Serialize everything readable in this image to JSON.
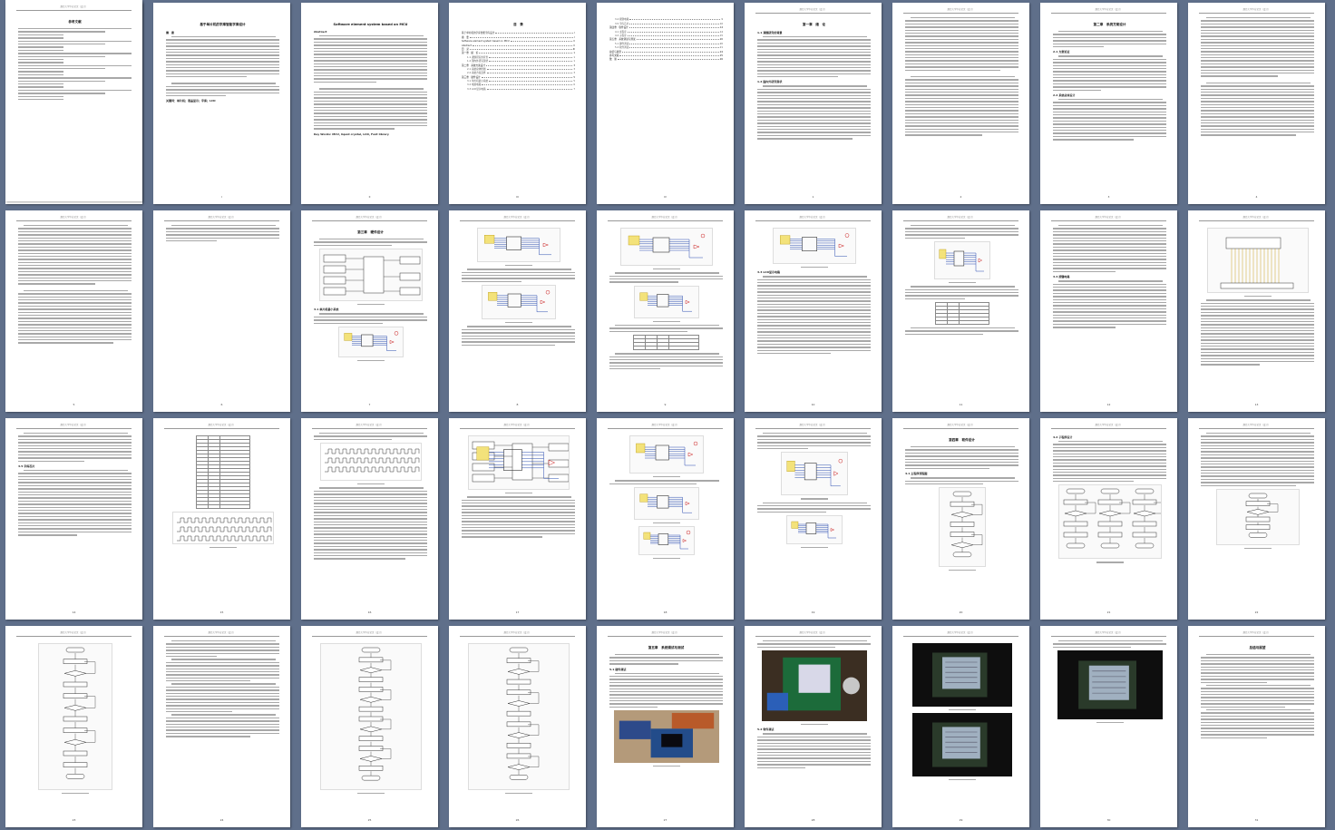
{
  "document": {
    "cover": {
      "title": "毕业论文",
      "fields": [
        {
          "label": "题　目",
          "value": "基于单片机的字库智能字库设计"
        },
        {
          "label": "学　院",
          "value": "信息科学与工程"
        },
        {
          "label": "专　业",
          "value": "电子信息工程"
        },
        {
          "label": "班　级",
          "value": "09级"
        },
        {
          "label": "指导老师",
          "value": "张　　平"
        },
        {
          "label": "起止日期",
          "value": "2013年2月—2013年5月"
        }
      ],
      "date": "2013年 6 月"
    },
    "abstract_cn": {
      "title": "基于单片机的字库智能字库设计",
      "heading": "摘　要",
      "keywords": "关键词：单片机；液晶显示；字库；LCD"
    },
    "abstract_en": {
      "title": "Software element system based on MCU",
      "heading": "Abstract",
      "keywords": "Key Words: MCU, liquid crystal, LCD, Font library"
    },
    "toc": {
      "heading": "目　录",
      "entries": [
        {
          "text": "基于单片机的字库智能字库设计",
          "page": "I"
        },
        {
          "text": "摘　要",
          "page": "I"
        },
        {
          "text": "Software element system based on MCU",
          "page": "II"
        },
        {
          "text": "Abstract",
          "page": "II"
        },
        {
          "text": "目　录",
          "page": "III"
        },
        {
          "text": "第一章　绪　论",
          "page": "1"
        },
        {
          "text": "1.1 课题研究的背景",
          "page": "1"
        },
        {
          "text": "1.2 国内外研究现状",
          "page": "1"
        },
        {
          "text": "第二章　系统方案设计",
          "page": "3"
        },
        {
          "text": "2.1 系统总体框图",
          "page": "3"
        },
        {
          "text": "2.2 系统方案选择",
          "page": "3"
        },
        {
          "text": "第三章　硬件设计",
          "page": "5"
        },
        {
          "text": "3.1 单片机最小系统",
          "page": "5"
        },
        {
          "text": "3.2 电源电路",
          "page": "6"
        },
        {
          "text": "3.3 LCD显示电路",
          "page": "7"
        }
      ]
    },
    "toc2": {
      "entries": [
        {
          "text": "3.4 按键电路",
          "page": "9"
        },
        {
          "text": "3.5 字库芯片",
          "page": "10"
        },
        {
          "text": "第四章　软件设计",
          "page": "14"
        },
        {
          "text": "4.1 主程序",
          "page": "14"
        },
        {
          "text": "4.2 子程序",
          "page": "15"
        },
        {
          "text": "第五章　系统调试与测试",
          "page": "20"
        },
        {
          "text": "5.1 硬件调试",
          "page": "20"
        },
        {
          "text": "5.2 软件调试",
          "page": "21"
        },
        {
          "text": "总结与展望",
          "page": "24"
        },
        {
          "text": "参考文献",
          "page": "25"
        },
        {
          "text": "致　谢",
          "page": "26"
        }
      ]
    },
    "chapter_headings": {
      "ch1": "第一章　绪　论",
      "ch2": "第二章　系统方案设计",
      "ch3": "第三章　硬件设计",
      "ch4": "第四章　软件设计",
      "ch5": "第五章　系统调试与测试",
      "summary": "总结与展望",
      "references": "参考文献"
    },
    "section_headings": {
      "s11": "1.1 课题研究的背景",
      "s12": "1.2 国内外研究现状",
      "s21": "2.1 方案论证",
      "s22": "2.2 系统总体设计",
      "s31": "3.1 单片机最小系统",
      "s33": "3.3 LCD显示电路",
      "s34": "3.4 按键电路",
      "s35": "3.5 字库芯片",
      "s41": "4.1 主程序流程图",
      "s42": "4.2 子程序设计",
      "s51": "5.1 硬件调试",
      "s52": "5.2 软件调试"
    },
    "header_text": "烟台大学毕业论文（设计）",
    "page_numbers": [
      "",
      "I",
      "II",
      "III",
      "IV",
      "1",
      "2",
      "3",
      "4",
      "5",
      "6",
      "7",
      "8",
      "9",
      "10",
      "11",
      "12",
      "13",
      "14",
      "15",
      "16",
      "17",
      "18",
      "19",
      "20",
      "21",
      "22",
      "23",
      "24",
      "25",
      "26",
      "27",
      "28",
      "29",
      "30",
      "31"
    ]
  }
}
